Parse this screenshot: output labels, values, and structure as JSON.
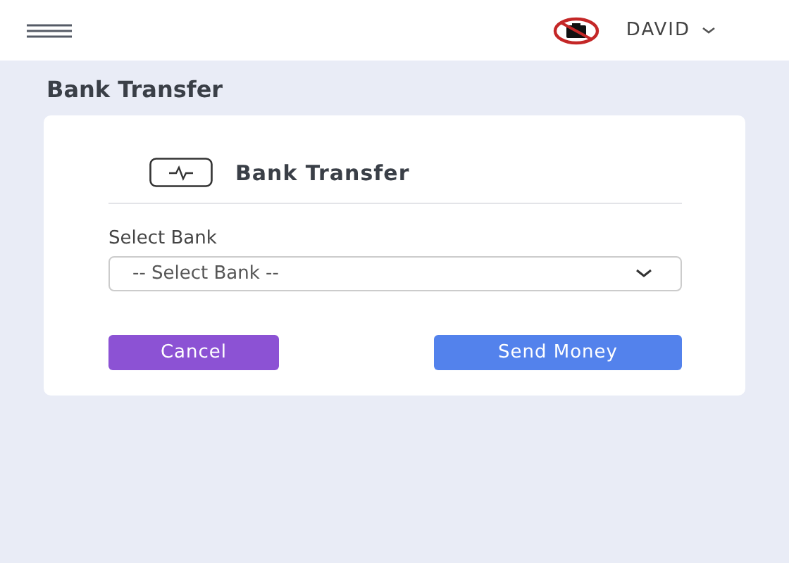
{
  "header": {
    "user_name": "DAVID"
  },
  "page_title": "Bank Transfer",
  "card": {
    "title": "Bank Transfer",
    "field_label": "Select Bank",
    "select": {
      "placeholder": "-- Select Bank --"
    },
    "buttons": [
      {
        "label": "Cancel",
        "kind": "secondary"
      },
      {
        "label": "Send Money",
        "kind": "primary"
      }
    ]
  }
}
